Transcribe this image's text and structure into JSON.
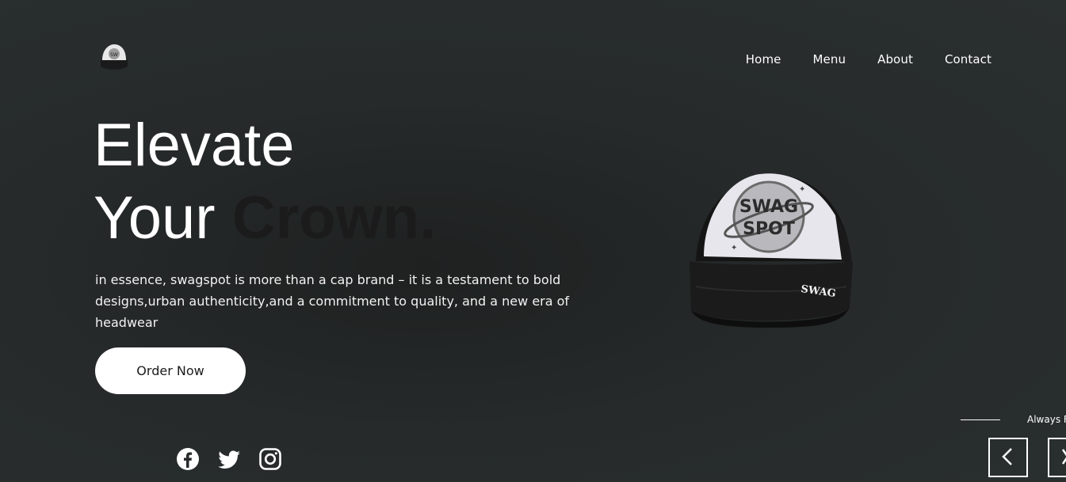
{
  "header": {
    "logo_icon": "swagspot-cap-logo-icon",
    "nav": [
      {
        "label": "Home"
      },
      {
        "label": "Menu"
      },
      {
        "label": "About"
      },
      {
        "label": "Contact"
      }
    ]
  },
  "hero": {
    "headline_line1": "Elevate",
    "headline_line2_plain": "Your ",
    "headline_line2_accent": "Crown.",
    "tagline": "in essence, swagspot is more than a cap brand – it is a testament to bold designs,urban authenticity,and a commitment to quality, and a new era of headwear",
    "cta_label": "Order Now"
  },
  "socials": [
    {
      "icon": "facebook-icon"
    },
    {
      "icon": "twitter-icon"
    },
    {
      "icon": "instagram-icon"
    }
  ],
  "product": {
    "image_icon": "trucker-cap-image"
  },
  "slider": {
    "caption": "Always F",
    "prev_icon": "chevron-left-icon",
    "next_icon": "close-icon"
  },
  "colors": {
    "background": "#262a2a",
    "text": "#ffffff",
    "accent_text": "#1c1b1b",
    "button_bg": "#ffffff"
  }
}
